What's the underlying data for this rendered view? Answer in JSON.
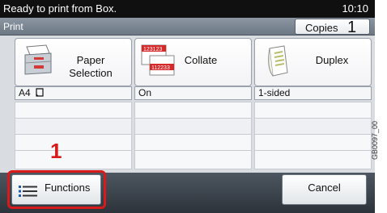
{
  "status": {
    "message": "Ready to print from Box.",
    "time": "10:10"
  },
  "title": {
    "text": "Print",
    "copies_label": "Copies",
    "copies_value": "1"
  },
  "tiles": {
    "paper": {
      "label_line1": "Paper",
      "label_line2": "Selection",
      "value": "A4",
      "icon": "paper-tray-icon"
    },
    "collate": {
      "label": "Collate",
      "value": "On",
      "icon": "collate-icon",
      "sheet_text_1": "123123",
      "sheet_text_2": "112233"
    },
    "duplex": {
      "label": "Duplex",
      "value": "1-sided",
      "icon": "duplex-icon"
    }
  },
  "bottom": {
    "functions_label": "Functions",
    "cancel_label": "Cancel"
  },
  "annotation": {
    "step": "1",
    "reference": "GB0097_00"
  },
  "colors": {
    "highlight": "#d81a1a",
    "status_bar": "#101010",
    "panel": "#d9dde2"
  }
}
